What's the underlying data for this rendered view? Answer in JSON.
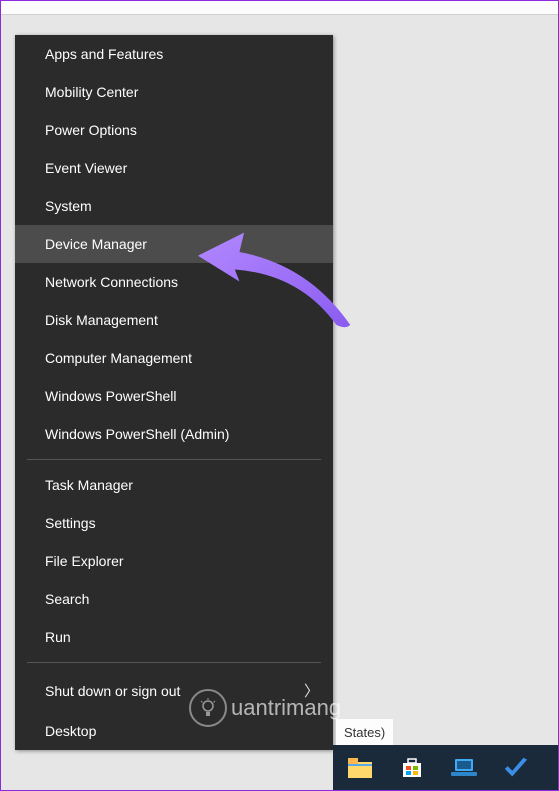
{
  "menu": {
    "group1": [
      {
        "label": "Apps and Features",
        "highlight": false
      },
      {
        "label": "Mobility Center",
        "highlight": false
      },
      {
        "label": "Power Options",
        "highlight": false
      },
      {
        "label": "Event Viewer",
        "highlight": false
      },
      {
        "label": "System",
        "highlight": false
      },
      {
        "label": "Device Manager",
        "highlight": true
      },
      {
        "label": "Network Connections",
        "highlight": false
      },
      {
        "label": "Disk Management",
        "highlight": false
      },
      {
        "label": "Computer Management",
        "highlight": false
      },
      {
        "label": "Windows PowerShell",
        "highlight": false
      },
      {
        "label": "Windows PowerShell (Admin)",
        "highlight": false
      }
    ],
    "group2": [
      {
        "label": "Task Manager"
      },
      {
        "label": "Settings"
      },
      {
        "label": "File Explorer"
      },
      {
        "label": "Search"
      },
      {
        "label": "Run"
      }
    ],
    "group3_submenu": {
      "label": "Shut down or sign out",
      "chevron": "〉"
    },
    "group3_item": {
      "label": "Desktop"
    }
  },
  "lang_indicator": "States)",
  "watermark": {
    "icon": "💡",
    "text": "uantrimang"
  },
  "annotation": {
    "arrow_color": "#a66cff"
  },
  "taskbar": {
    "icons": [
      "file-explorer-icon",
      "store-icon",
      "laptop-icon",
      "check-icon"
    ]
  }
}
